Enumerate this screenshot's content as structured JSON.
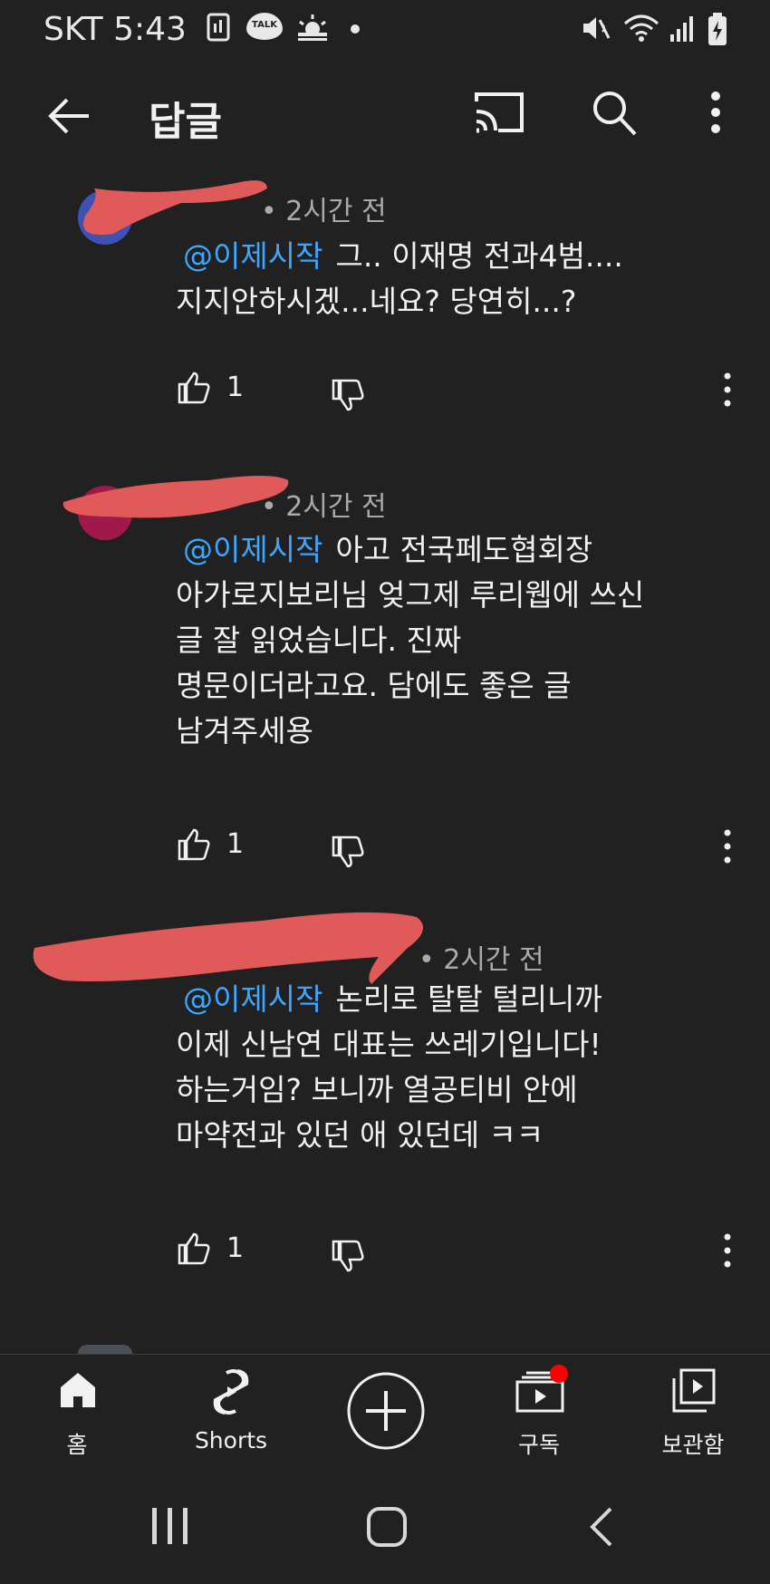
{
  "status_bar": {
    "carrier": "SKT",
    "time": "5:43",
    "notification_icons": [
      "screen-record-icon",
      "kakaotalk-icon",
      "weather-icon",
      "dot-icon"
    ],
    "kakao_badge": "TALK",
    "system_icons": [
      "mute-icon",
      "wifi-icon",
      "signal-icon",
      "battery-charging-icon"
    ]
  },
  "app_bar": {
    "title": "답글",
    "actions": [
      "cast-icon",
      "search-icon",
      "more-vert-icon"
    ]
  },
  "comments": [
    {
      "time": "• 2시간 전",
      "mention": "@이제시작",
      "text_lines": [
        "그.. 이재명 전과4범....",
        "지지안하시겠...네요? 당연히...?"
      ],
      "likes": "1",
      "avatar_color": "#3f51b5"
    },
    {
      "time": "• 2시간 전",
      "mention": "@이제시작",
      "text_lines": [
        "아고 전국페도협회장",
        "아가로지보리님 엊그제 루리웹에 쓰신",
        "글 잘 읽었습니다. 진짜",
        "명문이더라고요. 담에도 좋은 글",
        "남겨주세용"
      ],
      "likes": "1",
      "avatar_color": "#a0194a"
    },
    {
      "time": "• 2시간 전",
      "mention": "@이제시작",
      "text_lines": [
        "논리로 탈탈 털리니까",
        "이제 신남연 대표는 쓰레기입니다!",
        "하는거임? 보니까 열공티비 안에",
        "마약전과 있던 애 있던데 ㅋㅋ"
      ],
      "likes": "1",
      "avatar_color": "#607d8b"
    }
  ],
  "bottom_nav": {
    "items": [
      {
        "label": "홈",
        "icon": "home-icon"
      },
      {
        "label": "Shorts",
        "icon": "shorts-icon"
      },
      {
        "label": "",
        "icon": "create-icon"
      },
      {
        "label": "구독",
        "icon": "subscriptions-icon"
      },
      {
        "label": "보관함",
        "icon": "library-icon"
      }
    ]
  },
  "colors": {
    "background": "#212121",
    "mention": "#3ea6ff",
    "redaction": "#e05a5a",
    "notification_dot": "#ff0000"
  }
}
